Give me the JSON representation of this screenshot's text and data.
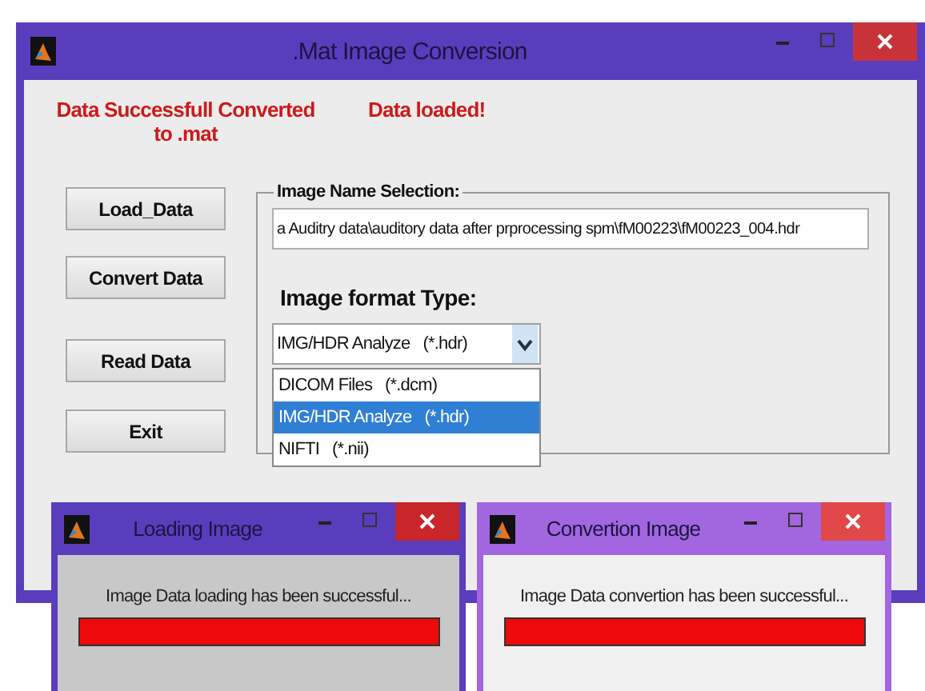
{
  "main_window": {
    "title": ".Mat Image Conversion",
    "status_messages": [
      "Data Successfull Converted to .mat",
      "Data loaded!"
    ],
    "buttons": [
      "Load_Data",
      "Convert Data",
      "Read Data",
      "Exit"
    ],
    "image_name_selection": {
      "title": "Image Name Selection:",
      "path_value": "a Auditry data\\auditory data after prprocessing spm\\fM00223\\fM00223_004.hdr"
    },
    "image_format": {
      "label": "Image format Type:",
      "dropdown": {
        "value": "IMG/HDR Analyze   (*.hdr)",
        "expanded": true,
        "options": [
          {
            "label": "DICOM Files   (*.dcm)",
            "selected": false
          },
          {
            "label": "IMG/HDR Analyze   (*.hdr)",
            "selected": true
          },
          {
            "label": "NIFTI   (*.nii)",
            "selected": false
          }
        ]
      }
    }
  },
  "dialogs": [
    {
      "title": "Loading Image",
      "active": true,
      "message": "Image Data loading has been successful...",
      "progress": {
        "level": 1
      }
    },
    {
      "title": "Convertion Image",
      "active": false,
      "message": "Image Data convertion has been successful...",
      "progress": {
        "level": 1
      }
    }
  ]
}
